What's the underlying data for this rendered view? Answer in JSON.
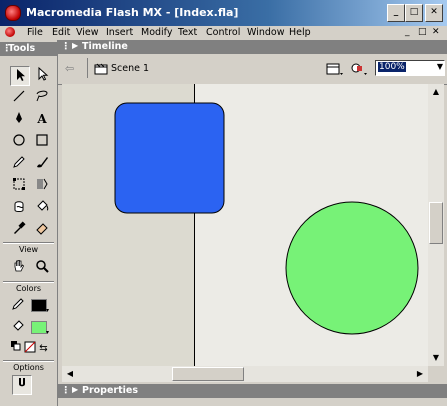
{
  "window": {
    "title": "Macromedia Flash MX - [Index.fla]",
    "minimize_glyph": "_",
    "maximize_glyph": "□",
    "close_glyph": "✕"
  },
  "menu": [
    "File",
    "Edit",
    "View",
    "Insert",
    "Modify",
    "Text",
    "Control",
    "Window",
    "Help"
  ],
  "mdi_controls": [
    "_",
    "□",
    "✕"
  ],
  "tools_panel": {
    "title": "Tools",
    "view_label": "View",
    "colors_label": "Colors",
    "options_label": "Options"
  },
  "timeline": {
    "title": "Timeline"
  },
  "editbar": {
    "scene_label": "Scene 1",
    "zoom_value": "100%"
  },
  "properties": {
    "title": "Properties"
  },
  "stage_shapes": {
    "rectangle_color": "#2b63f2",
    "circle_color": "#77f277"
  },
  "colors": {
    "stroke_swatch": "#000000",
    "fill_swatch": "#77f277"
  }
}
